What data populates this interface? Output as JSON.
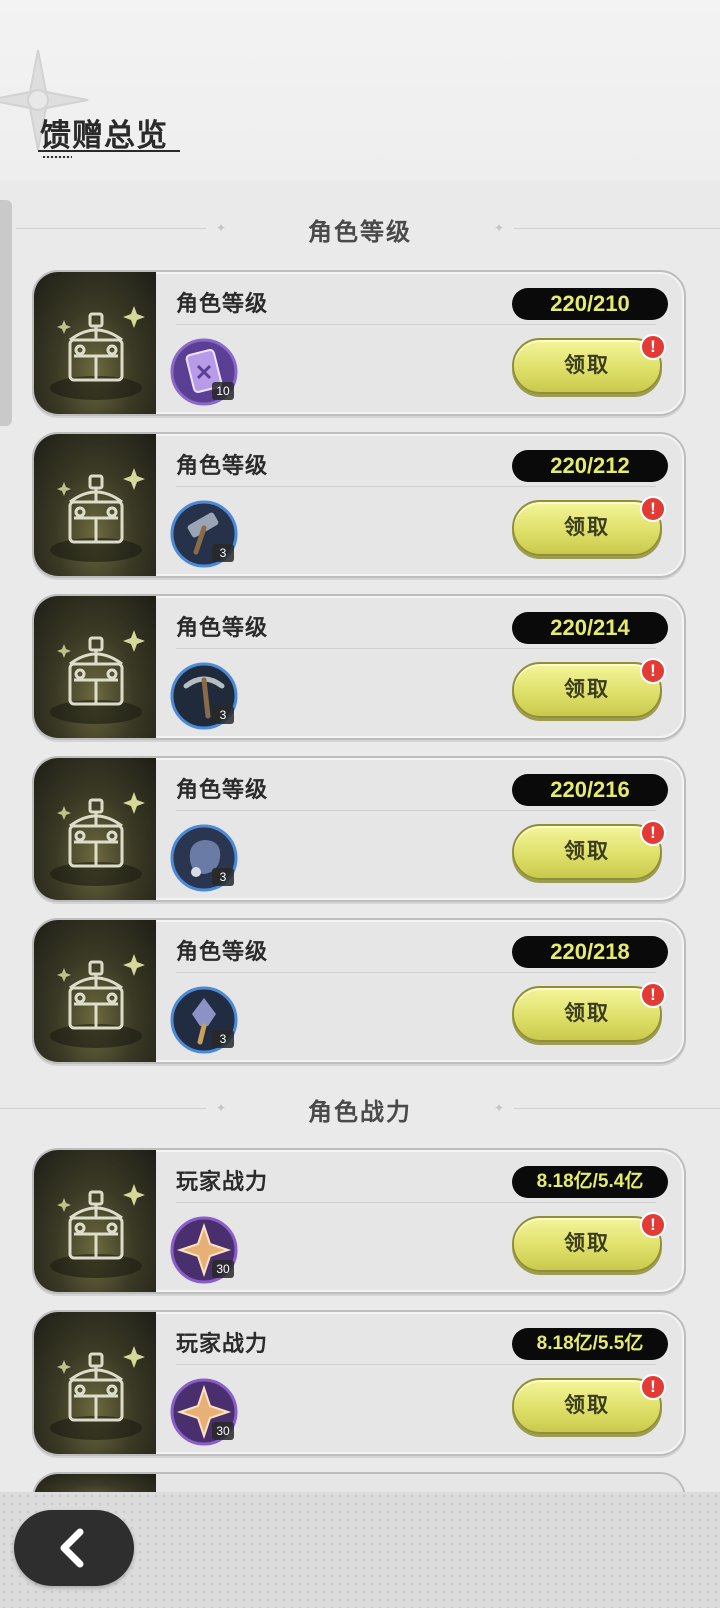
{
  "header": {
    "title": "馈赠总览"
  },
  "sections": [
    {
      "title": "角色等级"
    },
    {
      "title": "角色战力"
    }
  ],
  "cards": [
    {
      "title": "角色等级",
      "progress": "220/210",
      "reward_icon": "purple-card-icon",
      "reward_count": "10",
      "button": "领取",
      "alert": "!"
    },
    {
      "title": "角色等级",
      "progress": "220/212",
      "reward_icon": "hammer-icon",
      "reward_count": "3",
      "button": "领取",
      "alert": "!"
    },
    {
      "title": "角色等级",
      "progress": "220/214",
      "reward_icon": "pickaxe-icon",
      "reward_count": "3",
      "button": "领取",
      "alert": "!"
    },
    {
      "title": "角色等级",
      "progress": "220/216",
      "reward_icon": "ore-icon",
      "reward_count": "3",
      "button": "领取",
      "alert": "!"
    },
    {
      "title": "角色等级",
      "progress": "220/218",
      "reward_icon": "shovel-icon",
      "reward_count": "3",
      "button": "领取",
      "alert": "!"
    },
    {
      "title": "玩家战力",
      "progress": "8.18亿/5.4亿",
      "reward_icon": "star-crystal-icon",
      "reward_count": "30",
      "button": "领取",
      "alert": "!"
    },
    {
      "title": "玩家战力",
      "progress": "8.18亿/5.5亿",
      "reward_icon": "star-crystal-icon",
      "reward_count": "30",
      "button": "领取",
      "alert": "!"
    }
  ],
  "colors": {
    "accent_yellow": "#e6ec6a",
    "button_yellow": "#dfe06a",
    "alert_red": "#e23b36",
    "badge_black": "#0a0a0a"
  }
}
